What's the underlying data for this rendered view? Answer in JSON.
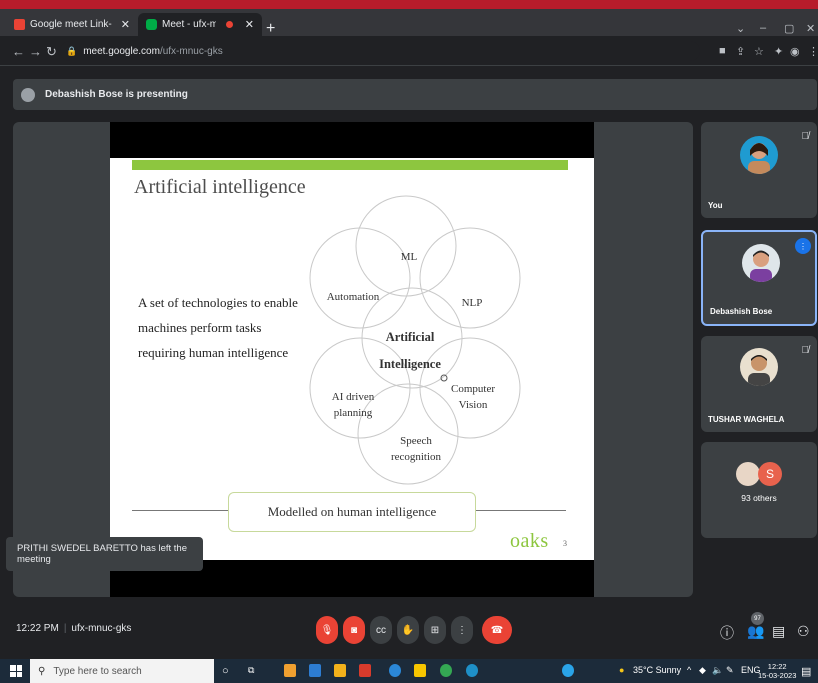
{
  "browser": {
    "tabs": [
      {
        "label": "Google meet Link- National level",
        "active": false
      },
      {
        "label": "Meet - ufx-mnuc-gks",
        "active": true
      }
    ],
    "url_host": "meet.google.com",
    "url_path": "/ufx-mnuc-gks"
  },
  "meet": {
    "presenting_text": "Debashish Bose is presenting",
    "toast": "PRITHI SWEDEL BARETTO has left the meeting",
    "participants": [
      {
        "name": "You",
        "muted": true
      },
      {
        "name": "Debashish Bose",
        "speaking": true
      },
      {
        "name": "TUSHAR WAGHELA",
        "muted": true
      },
      {
        "name": "93 others",
        "avatar_letter": "S"
      }
    ],
    "time": "12:22 PM",
    "meeting_code": "ufx-mnuc-gks",
    "people_count": "97"
  },
  "slide": {
    "title": "Artificial intelligence",
    "description": "A set of technologies to enable machines perform tasks requiring human intelligence",
    "center_line1": "Artificial",
    "center_line2": "Intelligence",
    "petals": {
      "ml": "ML",
      "nlp": "NLP",
      "cv_line1": "Computer",
      "cv_line2": "Vision",
      "speech_line1": "Speech",
      "speech_line2": "recognition",
      "planning_line1": "AI driven",
      "planning_line2": "planning",
      "automation": "Automation"
    },
    "footer": "Modelled on human intelligence",
    "logo": "oaks",
    "page_number": "3",
    "accent_color": "#8dc63f"
  },
  "taskbar": {
    "search_placeholder": "Type here to search",
    "weather": "35°C Sunny",
    "language": "ENG",
    "clock_time": "12:22",
    "clock_date": "15-03-2023"
  }
}
